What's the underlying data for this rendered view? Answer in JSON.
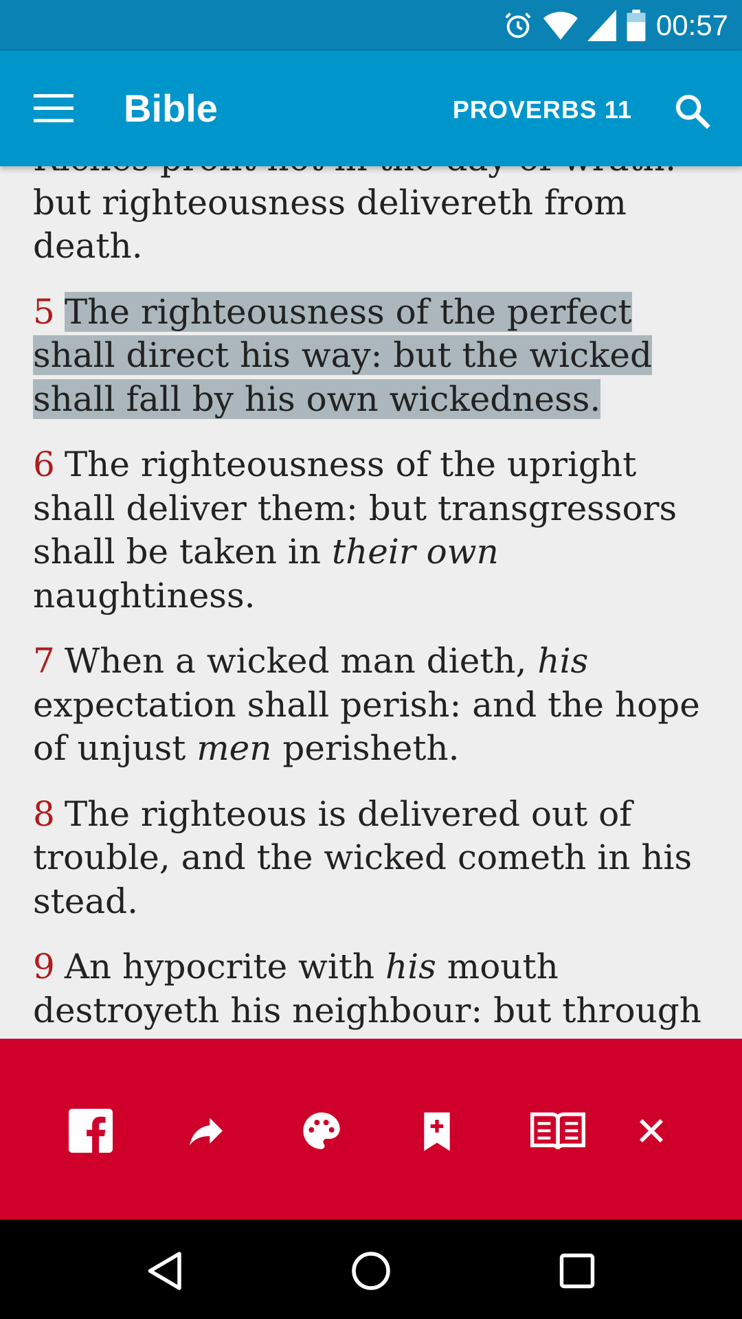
{
  "status_bar": {
    "time": "00:57",
    "icons": [
      "alarm-icon",
      "wifi-icon",
      "signal-icon",
      "battery-icon"
    ]
  },
  "app_bar": {
    "title": "Bible",
    "chapter": "PROVERBS 11",
    "icons": [
      "menu-icon",
      "search-icon"
    ]
  },
  "verses": [
    {
      "number": "",
      "parts": [
        {
          "t": "Riches profit not in the day of wrath: but righteousness delivereth from death."
        }
      ]
    },
    {
      "number": "5",
      "highlighted": true,
      "parts": [
        {
          "t": "The righteousness of the perfect shall direct his way: but the wicked shall fall by his own wickedness."
        }
      ]
    },
    {
      "number": "6",
      "parts": [
        {
          "t": "The righteousness of the upright shall deliver them: but transgressors shall be taken in "
        },
        {
          "t": "their own",
          "italic": true
        },
        {
          "t": " naughtiness."
        }
      ]
    },
    {
      "number": "7",
      "parts": [
        {
          "t": "When a wicked man dieth, "
        },
        {
          "t": "his",
          "italic": true
        },
        {
          "t": " expectation shall perish: and the hope of unjust "
        },
        {
          "t": "men",
          "italic": true
        },
        {
          "t": " perisheth."
        }
      ]
    },
    {
      "number": "8",
      "parts": [
        {
          "t": "The righteous is delivered out of trouble, and the wicked cometh in his stead."
        }
      ]
    },
    {
      "number": "9",
      "parts": [
        {
          "t": "An hypocrite with "
        },
        {
          "t": "his",
          "italic": true
        },
        {
          "t": " mouth destroyeth his neighbour: but through knowledge shall the just be delivered."
        }
      ]
    }
  ],
  "action_bar": {
    "actions": [
      "facebook-icon",
      "share-icon",
      "palette-icon",
      "bookmark-add-icon",
      "open-book-icon",
      "close-icon"
    ]
  },
  "nav_bar": {
    "buttons": [
      "back-icon",
      "home-icon",
      "recents-icon"
    ]
  },
  "colors": {
    "status_bar": "#0a82b3",
    "app_bar": "#0096cc",
    "verse_number": "#b01b1b",
    "highlight": "#abb7bd",
    "action_bar": "#cf0029",
    "background": "#eeeeee"
  }
}
